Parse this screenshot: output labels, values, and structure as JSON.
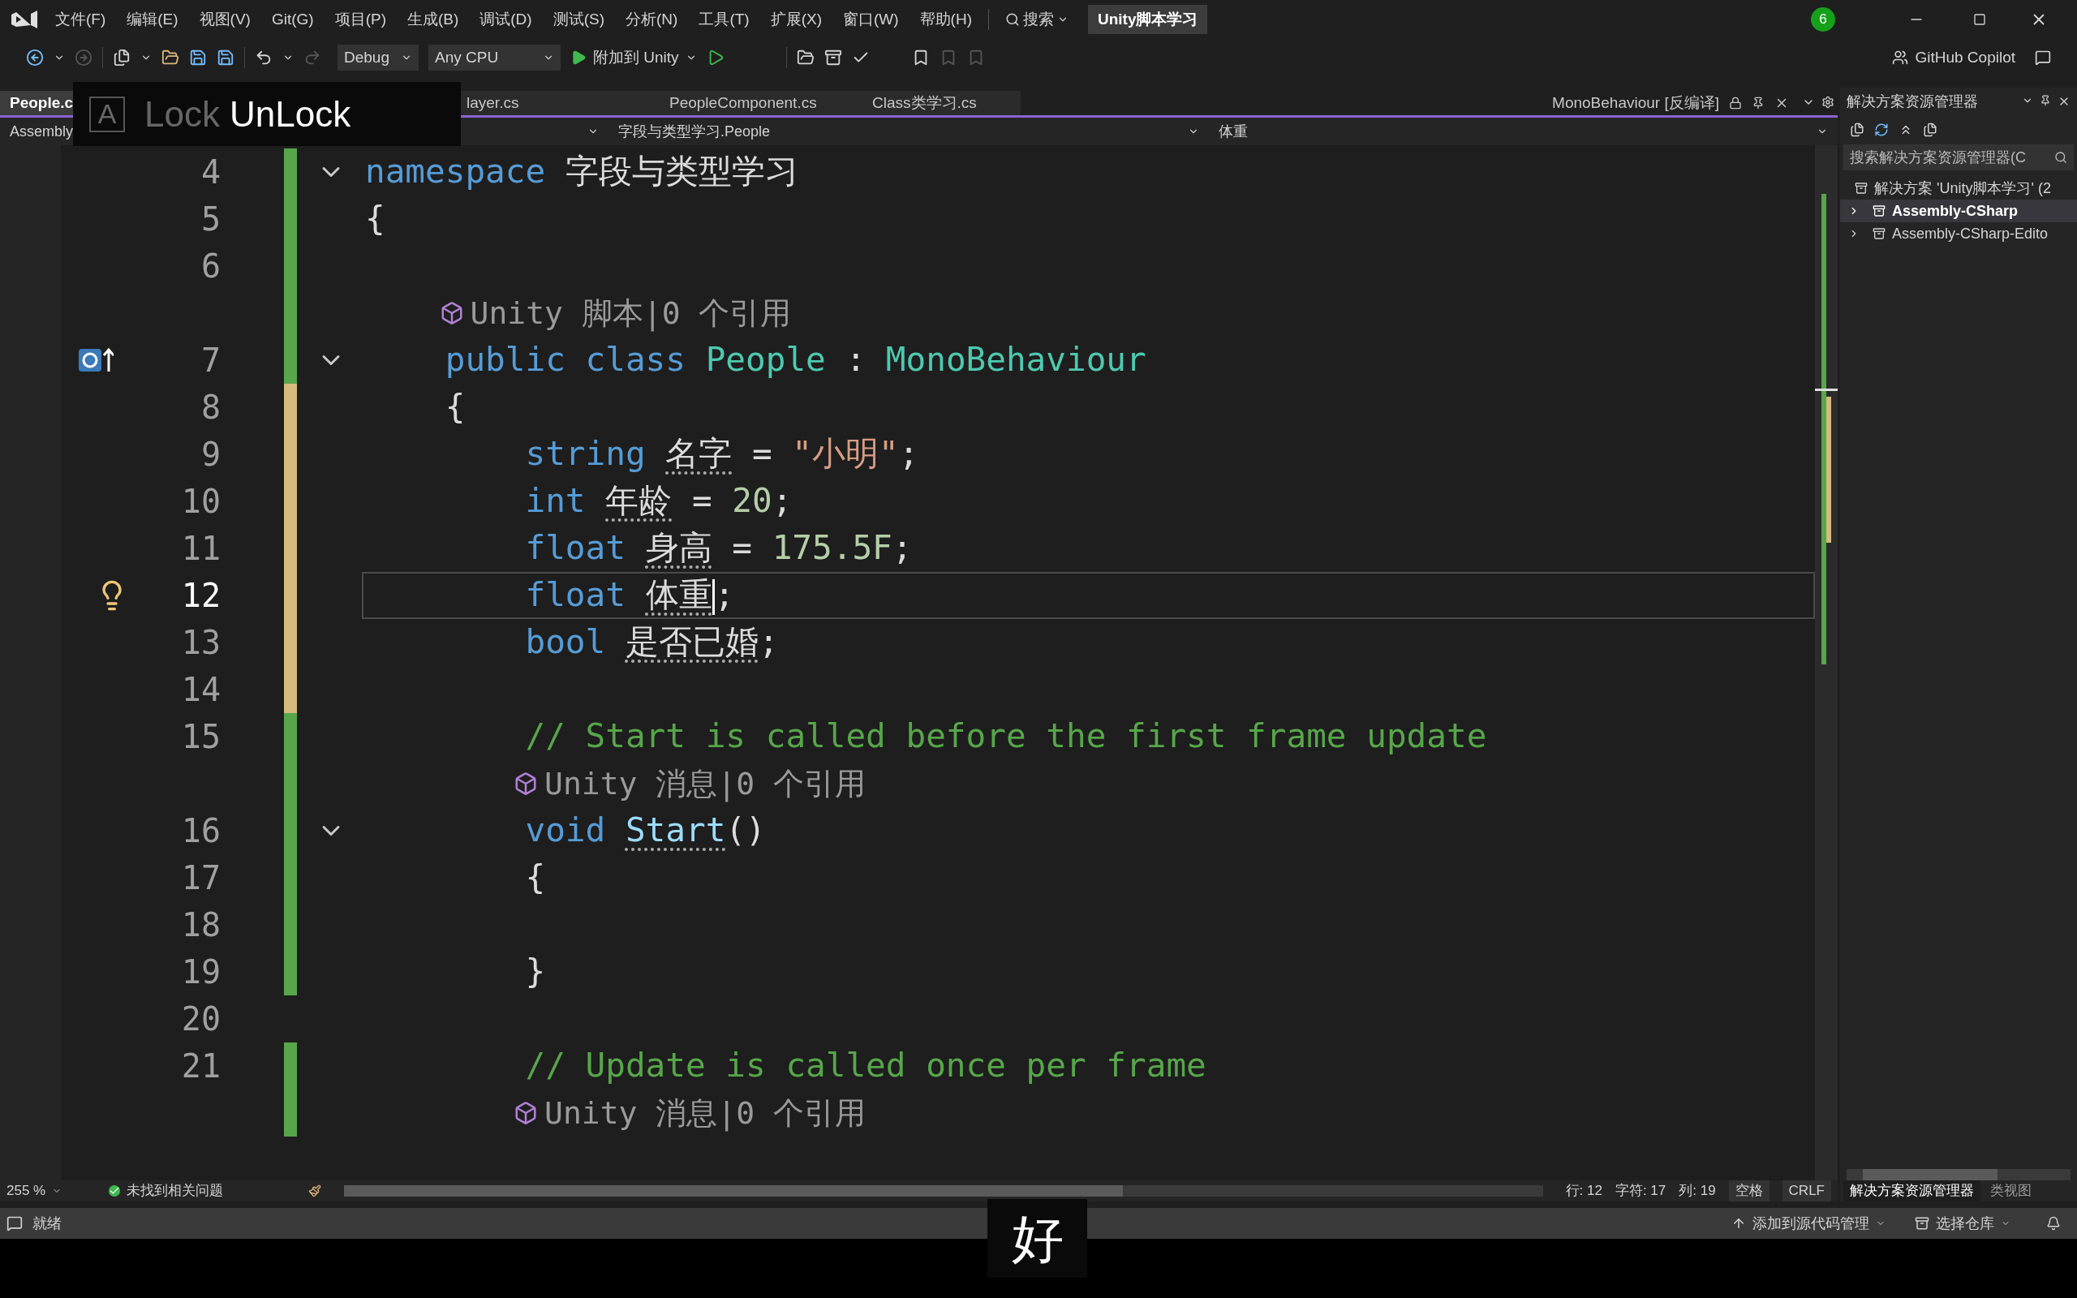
{
  "title_bar": {
    "menu": [
      "文件(F)",
      "编辑(E)",
      "视图(V)",
      "Git(G)",
      "项目(P)",
      "生成(B)",
      "调试(D)",
      "测试(S)",
      "分析(N)",
      "工具(T)",
      "扩展(X)",
      "窗口(W)",
      "帮助(H)"
    ],
    "search": "搜索",
    "solution_title": "Unity脚本学习",
    "badge": "6"
  },
  "toolbar": {
    "configuration": "Debug",
    "platform": "Any CPU",
    "attach": "附加到 Unity",
    "copilot": "GitHub Copilot"
  },
  "tabs": [
    {
      "label": "People.c",
      "selected": true
    },
    {
      "label": "layer.cs",
      "selected": false
    },
    {
      "label": "PeopleComponent.cs",
      "selected": false
    },
    {
      "label": "Class类学习.cs",
      "selected": false
    }
  ],
  "preview_tab": "MonoBehaviour [反编译]",
  "nav_bar": {
    "project": "Assembly",
    "type": "字段与类型学习.People",
    "member": "体重"
  },
  "code": [
    {
      "n": "4",
      "kind": "saved",
      "fold": true,
      "tokens": [
        {
          "t": "namespace",
          "kind": "kw"
        },
        {
          "t": " 字段与类型学习",
          "kind": "plain"
        }
      ]
    },
    {
      "n": "5",
      "kind": "saved",
      "tokens": [
        {
          "t": "{",
          "kind": "plain"
        }
      ]
    },
    {
      "n": "6",
      "kind": "saved"
    },
    {
      "n": "7",
      "kind": "saved",
      "fold": true,
      "glyph": {
        "kind": "override"
      },
      "lens": "Unity 脚本|0 个引用",
      "tokens": [
        {
          "t": "    public",
          "kind": "kw"
        },
        {
          "t": " class",
          "kind": "kw"
        },
        {
          "t": " People",
          "kind": "type"
        },
        {
          "t": " : ",
          "kind": "plain"
        },
        {
          "t": "MonoBehaviour",
          "kind": "type"
        }
      ]
    },
    {
      "n": "8",
      "kind": "edited",
      "tokens": [
        {
          "t": "    {",
          "kind": "plain"
        }
      ]
    },
    {
      "n": "9",
      "kind": "edited",
      "tokens": [
        {
          "t": "        string",
          "kind": "kw"
        },
        {
          "t": " 名字",
          "kind": "plain",
          "hint": true
        },
        {
          "t": " = ",
          "kind": "plain"
        },
        {
          "t": "\"小明\"",
          "kind": "str"
        },
        {
          "t": ";",
          "kind": "plain"
        }
      ]
    },
    {
      "n": "10",
      "kind": "edited",
      "tokens": [
        {
          "t": "        int",
          "kind": "kw"
        },
        {
          "t": " 年龄",
          "kind": "plain",
          "hint": true
        },
        {
          "t": " = ",
          "kind": "plain"
        },
        {
          "t": "20",
          "kind": "num"
        },
        {
          "t": ";",
          "kind": "plain"
        }
      ]
    },
    {
      "n": "11",
      "kind": "edited",
      "tokens": [
        {
          "t": "        float",
          "kind": "kw"
        },
        {
          "t": " 身高",
          "kind": "plain",
          "hint": true
        },
        {
          "t": " = ",
          "kind": "plain"
        },
        {
          "t": "175.5F",
          "kind": "num"
        },
        {
          "t": ";",
          "kind": "plain"
        }
      ]
    },
    {
      "n": "12",
      "kind": "edited",
      "current": true,
      "glyph": {
        "kind": "lightbulb"
      },
      "tokens": [
        {
          "t": "        float",
          "kind": "kw"
        },
        {
          "t": " 体重",
          "kind": "plain",
          "hint": true,
          "caret": true
        },
        {
          "t": ";",
          "kind": "plain"
        }
      ]
    },
    {
      "n": "13",
      "kind": "edited",
      "tokens": [
        {
          "t": "        bool",
          "kind": "kw"
        },
        {
          "t": " 是否已婚",
          "kind": "plain",
          "hint": true
        },
        {
          "t": ";",
          "kind": "plain"
        }
      ]
    },
    {
      "n": "14",
      "kind": "edited"
    },
    {
      "n": "15",
      "kind": "saved",
      "tokens": [
        {
          "t": "        // Start is called before the first frame update",
          "kind": "comment"
        }
      ]
    },
    {
      "n": "16",
      "kind": "saved",
      "fold": true,
      "lens": "Unity 消息|0 个引用",
      "tokens": [
        {
          "t": "        void",
          "kind": "kw"
        },
        {
          "t": " Start",
          "kind": "method",
          "hint": true
        },
        {
          "t": "()",
          "kind": "plain"
        }
      ]
    },
    {
      "n": "17",
      "kind": "saved",
      "tokens": [
        {
          "t": "        {",
          "kind": "plain"
        }
      ]
    },
    {
      "n": "18",
      "kind": "saved"
    },
    {
      "n": "19",
      "kind": "saved",
      "tokens": [
        {
          "t": "        }",
          "kind": "plain"
        }
      ]
    },
    {
      "n": "20",
      "kind": "unchanged"
    },
    {
      "n": "21",
      "kind": "saved",
      "tokens": [
        {
          "t": "        // Update is called once per frame",
          "kind": "comment"
        }
      ]
    },
    {
      "kind": "saved",
      "lens": "Unity 消息|0 个引用"
    }
  ],
  "status": {
    "zoom": "255 %",
    "issues": "未找到相关问题",
    "line": "行: 12",
    "char": "字符: 17",
    "col": "列: 19",
    "spacing": "空格",
    "eol": "CRLF"
  },
  "solution_explorer": {
    "title": "解决方案资源管理器",
    "search_placeholder": "搜索解决方案资源管理器(C",
    "tree": [
      {
        "label": "解决方案 'Unity脚本学习' (2",
        "children": [
          {
            "label": "Assembly-CSharp",
            "selected": true
          },
          {
            "label": "Assembly-CSharp-Edito",
            "selected": false
          }
        ]
      }
    ],
    "tabs": [
      {
        "label": "解决方案资源管理器",
        "selected": true
      },
      {
        "label": "类视图",
        "selected": false
      }
    ]
  },
  "ready_bar": {
    "status": "就绪",
    "source_control": "添加到源代码管理",
    "repository": "选择仓库"
  },
  "key_overlay": {
    "glyph": "A",
    "keys": [
      {
        "label": "Lock",
        "active": false
      },
      {
        "label": "UnLock",
        "active": true
      }
    ]
  },
  "subtitle": "好"
}
